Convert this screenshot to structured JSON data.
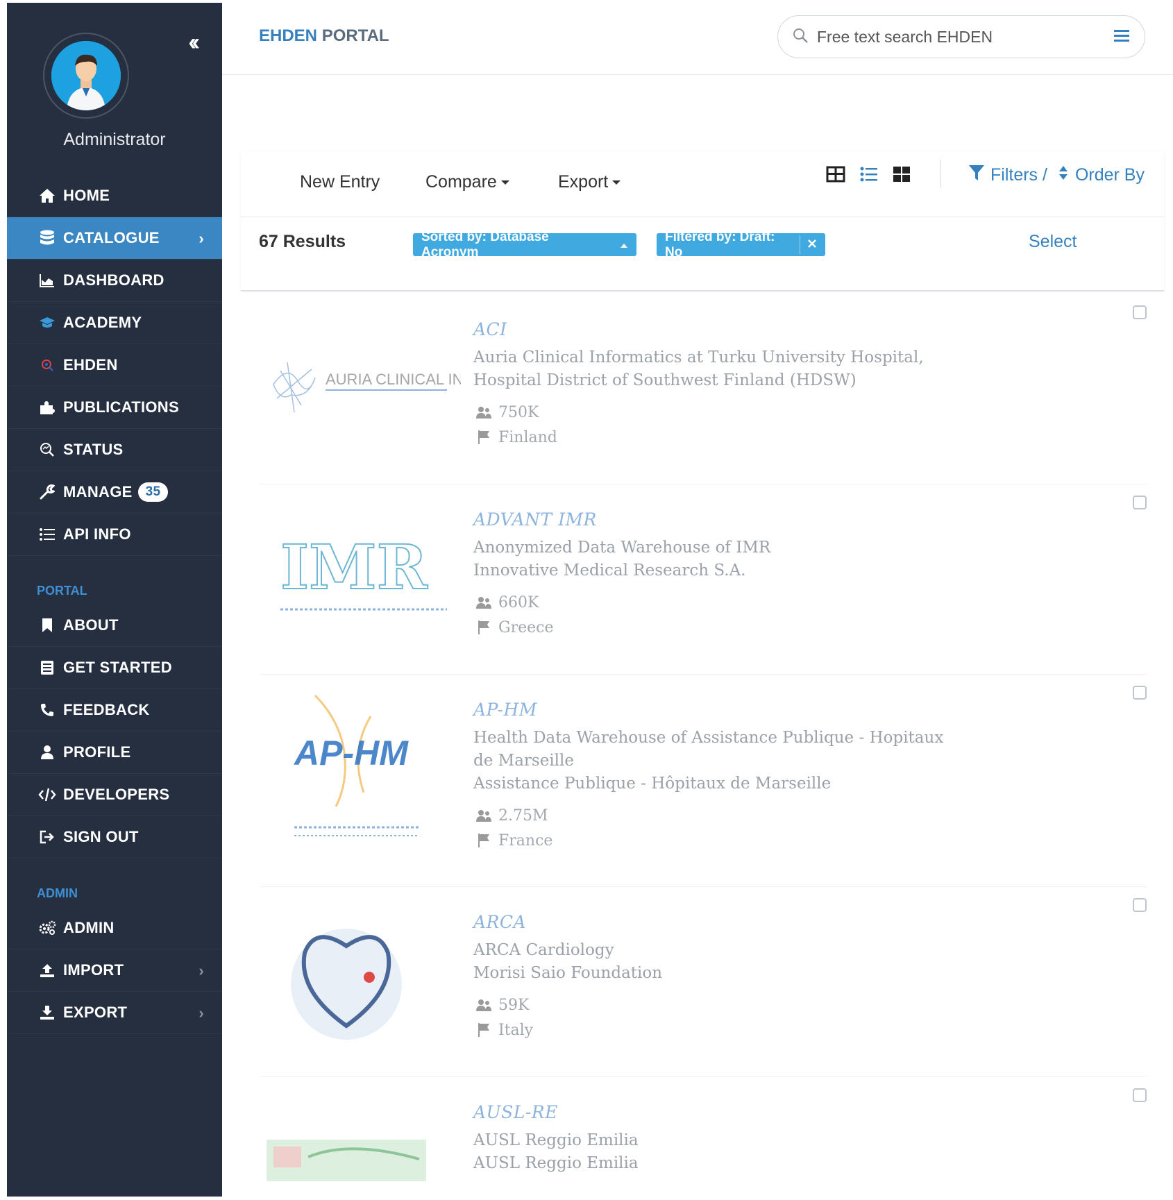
{
  "sidebar": {
    "collapse_icon": "chevrons-left-icon",
    "user": {
      "name": "Administrator"
    },
    "items": [
      {
        "label": "HOME",
        "icon": "home-icon"
      },
      {
        "label": "CATALOGUE",
        "icon": "database-icon",
        "active": true
      },
      {
        "label": "DASHBOARD",
        "icon": "chart-icon"
      },
      {
        "label": "ACADEMY",
        "icon": "graduation-cap-icon"
      },
      {
        "label": "EHDEN",
        "icon": "ehden-icon"
      },
      {
        "label": "PUBLICATIONS",
        "icon": "puzzle-icon"
      },
      {
        "label": "STATUS",
        "icon": "search-status-icon"
      },
      {
        "label": "MANAGE",
        "icon": "wrench-icon",
        "badge": "35"
      },
      {
        "label": "API INFO",
        "icon": "list-icon"
      }
    ],
    "portal_section": {
      "title": "PORTAL",
      "items": [
        {
          "label": "ABOUT",
          "icon": "bookmark-icon"
        },
        {
          "label": "GET STARTED",
          "icon": "book-icon"
        },
        {
          "label": "FEEDBACK",
          "icon": "phone-icon"
        },
        {
          "label": "PROFILE",
          "icon": "user-icon"
        },
        {
          "label": "DEVELOPERS",
          "icon": "code-icon"
        },
        {
          "label": "SIGN OUT",
          "icon": "sign-out-icon"
        }
      ]
    },
    "admin_section": {
      "title": "ADMIN",
      "items": [
        {
          "label": "ADMIN",
          "icon": "cogs-icon"
        },
        {
          "label": "IMPORT",
          "icon": "upload-icon"
        },
        {
          "label": "EXPORT",
          "icon": "download-icon"
        }
      ]
    }
  },
  "header": {
    "brand_primary": "EHDEN",
    "brand_secondary": "PORTAL",
    "search_placeholder": "Free text search EHDEN"
  },
  "toolbar": {
    "new_entry": "New Entry",
    "compare": "Compare",
    "export": "Export",
    "filters": "Filters /",
    "order_by": "Order By"
  },
  "results": {
    "count": "67 Results",
    "sort_chip": "Sorted by: Database Acronym",
    "filter_chip": "Filtered by: Draft: No",
    "select": "Select"
  },
  "entries": [
    {
      "acronym": "ACI",
      "name": "Auria Clinical Informatics at Turku University Hospital, Hospital District of Southwest Finland (HDSW)",
      "org": "",
      "persons": "750K",
      "country": "Finland",
      "logo_text": "AURIA CLINICAL INFORMATICS"
    },
    {
      "acronym": "ADVANT IMR",
      "name": "Anonymized Data Warehouse of IMR",
      "org": "Innovative Medical Research S.A.",
      "persons": "660K",
      "country": "Greece",
      "logo_text": "IMR"
    },
    {
      "acronym": "AP-HM",
      "name": "Health Data Warehouse of Assistance Publique - Hopitaux de Marseille",
      "org": "Assistance Publique - Hôpitaux de Marseille",
      "persons": "2.75M",
      "country": "France",
      "logo_text": "AP-HM"
    },
    {
      "acronym": "ARCA",
      "name": "ARCA Cardiology",
      "org": "Morisi Saio Foundation",
      "persons": "59K",
      "country": "Italy",
      "logo_text": ""
    },
    {
      "acronym": "AUSL-RE",
      "name": "AUSL Reggio Emilia",
      "org": "AUSL Reggio Emilia",
      "persons": "",
      "country": "",
      "logo_text": ""
    }
  ]
}
